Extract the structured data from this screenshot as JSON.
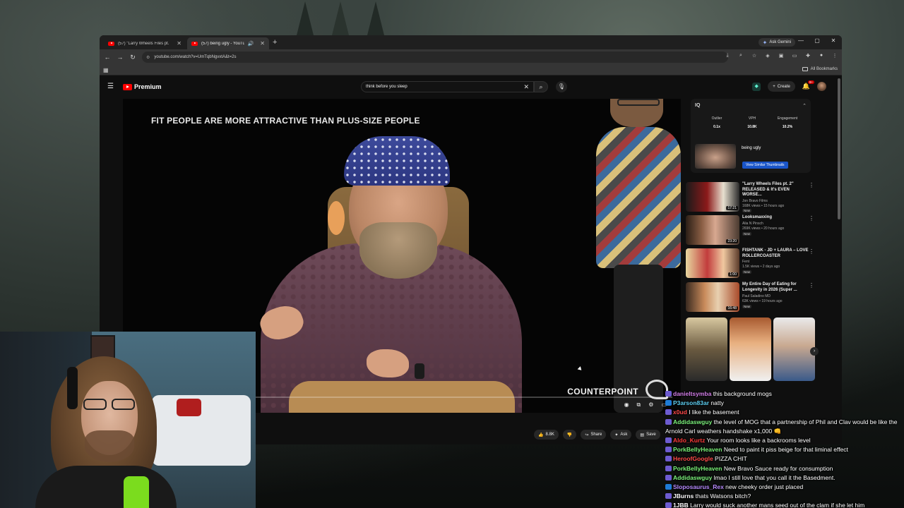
{
  "browser": {
    "tabs": [
      {
        "title": "(57) \"Larry Wheels Files pt. 2\" R",
        "active": false
      },
      {
        "title": "(57) being ugly - YouTube",
        "active": true
      }
    ],
    "gemini_label": "Ask Gemini",
    "url": "youtube.com/watch?v=UmTqbNgvxtA&t=2s",
    "all_bookmarks": "All Bookmarks"
  },
  "youtube": {
    "logo_text": "Premium",
    "search_query": "think before you sleep",
    "create_label": "Create",
    "notification_count": "9+"
  },
  "video": {
    "caption": "FIT PEOPLE ARE MORE ATTRACTIVE THAN PLUS-SIZE PEOPLE",
    "brand": "COUNTERPOINT",
    "progress_fraction": 0.02,
    "actions": {
      "likes": "8.8K",
      "share": "Share",
      "ask": "Ask",
      "save": "Save"
    }
  },
  "vidiq": {
    "metrics": [
      {
        "label": "Outlier",
        "value": "0.1x"
      },
      {
        "label": "VPH",
        "value": "10.8K"
      },
      {
        "label": "Engagement",
        "value": "10.2%"
      }
    ],
    "current_title": "being ugly",
    "similar_button": "View Similar Thumbnails"
  },
  "recommendations": [
    {
      "title": "\"Larry Wheels Files pt. 2\" RELEASED & It's EVEN WORSE...",
      "channel": "Jon Bravo Films",
      "meta": "168K views • 15 hours ago",
      "badge": "New",
      "duration": "17:21"
    },
    {
      "title": "Looksmaxxing",
      "channel": "Alia N Pinsch",
      "meta": "269K views • 20 hours ago",
      "badge": "New",
      "duration": "23:20"
    },
    {
      "title": "FISHTANK - JD + LAURA – LOVE ROLLERCOASTER",
      "channel": "Fent",
      "meta": "1.5K views • 2 days ago",
      "badge": "New",
      "duration": "1:00"
    },
    {
      "title": "My Entire Day of Eating for Longevity in 2026 (Super ...",
      "channel": "Paul Saladino MD",
      "meta": "63K views • 19 hours ago",
      "badge": "New",
      "duration": "16:48"
    }
  ],
  "chat": [
    {
      "user": "danieltsymba",
      "color": "#d37ee8",
      "msg": " this background mogs"
    },
    {
      "user": "P3arson83ar",
      "color": "#5ecff2",
      "msg": " natty"
    },
    {
      "user": "x0ud",
      "color": "#ff4a4a",
      "msg": " I like the basement"
    },
    {
      "user": "Addidaswguy",
      "color": "#7cf27c",
      "msg": " the level of MOG that a partnership of Phil and Clav would be like the Arnold Carl weathers handshake x1,000 👊"
    },
    {
      "user": "Aldo_Kurtz",
      "color": "#ff3b3b",
      "msg": " Your room looks like a backrooms level"
    },
    {
      "user": "PorkBellyHeaven",
      "color": "#79f278",
      "msg": " Need to paint it piss beige for that liminal effect"
    },
    {
      "user": "HeroofGoogle",
      "color": "#ff4a4a",
      "msg": " PIZZA CHIT"
    },
    {
      "user": "PorkBellyHeaven",
      "color": "#79f278",
      "msg": " New Bravo Sauce ready for consumption"
    },
    {
      "user": "Addidaswguy",
      "color": "#7cf27c",
      "msg": " lmao I still love that you call it the Basedment."
    },
    {
      "user": "Sloposaurus_Rex",
      "color": "#b78bff",
      "msg": " new cheeky order just placed"
    },
    {
      "user": "JBurns",
      "color": "#ffffff",
      "msg": " thats Watsons bitch?"
    },
    {
      "user": "1JBB",
      "color": "#ffffff",
      "msg": " Larry would suck another mans seed out of the clam if she let him"
    }
  ]
}
